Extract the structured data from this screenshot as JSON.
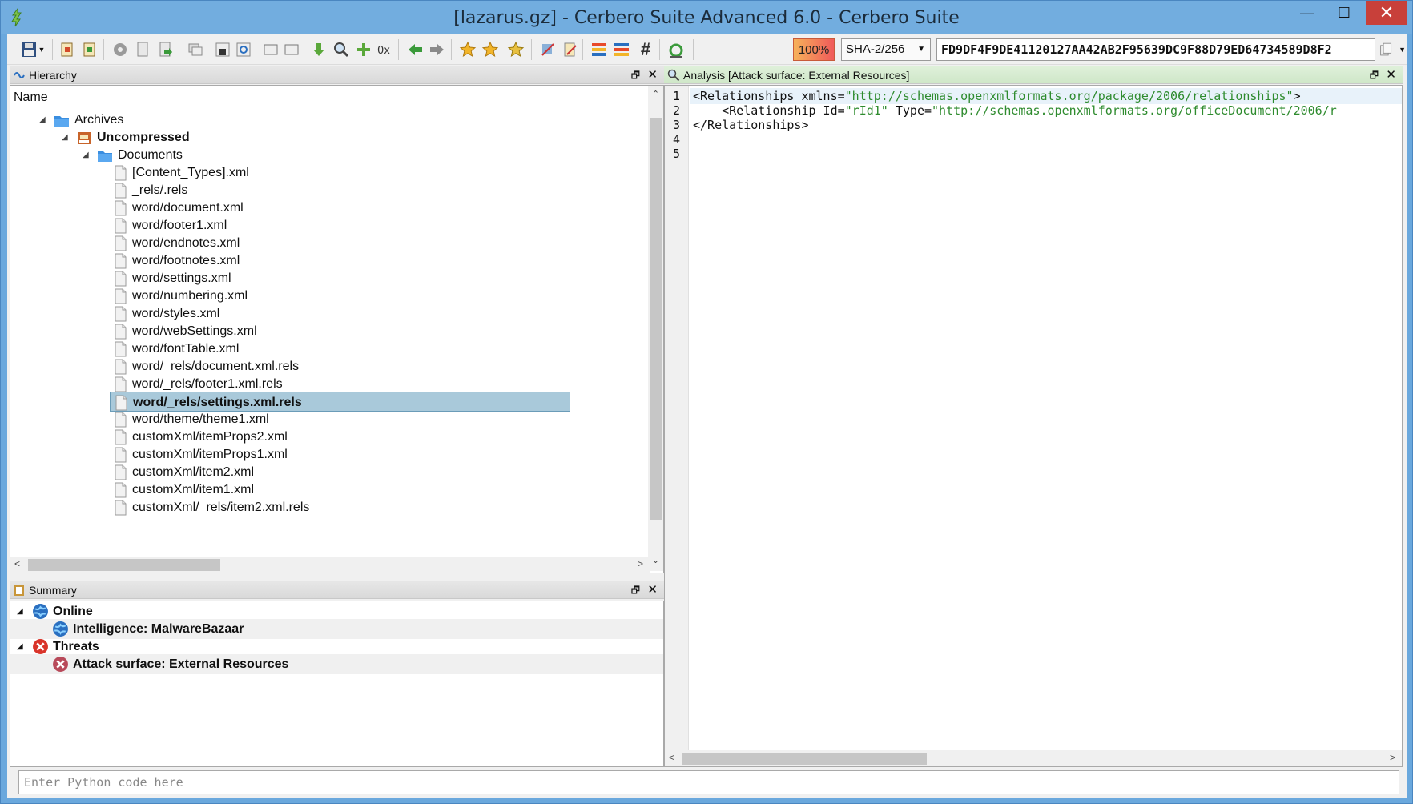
{
  "window": {
    "title": "[lazarus.gz] - Cerbero Suite Advanced 6.0 - Cerbero Suite",
    "minimize_glyph": "—",
    "maximize_glyph": "☐",
    "close_glyph": "✕"
  },
  "toolbar": {
    "zoom": "100%",
    "hash_algorithm": "SHA-2/256",
    "hash_value": "FD9DF4F9DE41120127AA42AB2F95639DC9F88D79ED64734589D8F2",
    "accent_zoom_color": "#f05a5a"
  },
  "hierarchy": {
    "title": "Hierarchy",
    "column_name": "Name",
    "float_glyph": "🗗",
    "close_glyph": "✕",
    "tree": [
      {
        "label": "Archives",
        "bold": false,
        "icon": "folder-icon"
      },
      {
        "label": "Uncompressed",
        "bold": true,
        "icon": "archive-icon"
      },
      {
        "label": "Documents",
        "bold": false,
        "icon": "folder-icon"
      }
    ],
    "files": [
      "[Content_Types].xml",
      "_rels/.rels",
      "word/document.xml",
      "word/footer1.xml",
      "word/endnotes.xml",
      "word/footnotes.xml",
      "word/settings.xml",
      "word/numbering.xml",
      "word/styles.xml",
      "word/webSettings.xml",
      "word/fontTable.xml",
      "word/_rels/document.xml.rels",
      "word/_rels/footer1.xml.rels",
      "word/_rels/settings.xml.rels",
      "word/theme/theme1.xml",
      "customXml/itemProps2.xml",
      "customXml/itemProps1.xml",
      "customXml/item2.xml",
      "customXml/item1.xml",
      "customXml/_rels/item2.xml.rels"
    ],
    "selected_file": "word/_rels/settings.xml.rels"
  },
  "summary": {
    "title": "Summary",
    "float_glyph": "🗗",
    "close_glyph": "✕",
    "groups": [
      {
        "label": "Online",
        "icon": "globe-icon",
        "item": "Intelligence: MalwareBazaar",
        "item_icon": "globe-icon"
      },
      {
        "label": "Threats",
        "icon": "threat-icon",
        "item": "Attack surface: External Resources",
        "item_icon": "threat-icon"
      }
    ]
  },
  "analysis": {
    "title": "Analysis [Attack surface: External Resources]",
    "float_glyph": "🗗",
    "close_glyph": "✕",
    "line_numbers": [
      "1",
      "2",
      "3",
      "4",
      "5"
    ],
    "lines": [
      {
        "pre": "<Relationships xmlns=",
        "str": "\"http://schemas.openxmlformats.org/package/2006/relationships\"",
        "post": ">"
      },
      {
        "pre": "    <Relationship Id=",
        "str": "\"rId1\"",
        "post": " Type=",
        "str2": "\"http://schemas.openxmlformats.org/officeDocument/2006/r"
      },
      {
        "pre": "</Relationships>",
        "str": "",
        "post": ""
      }
    ]
  },
  "python": {
    "placeholder": "Enter Python code here"
  }
}
